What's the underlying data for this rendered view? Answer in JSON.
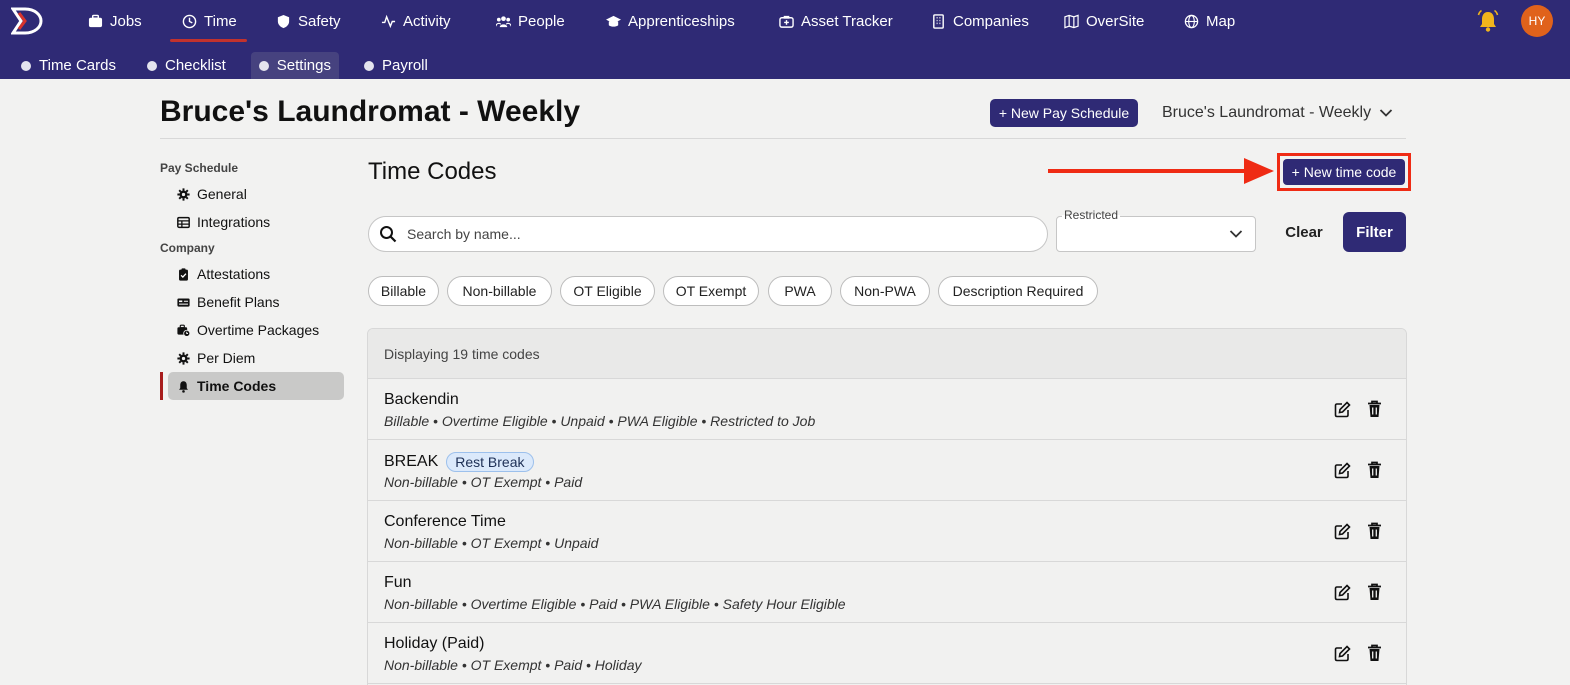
{
  "colors": {
    "nav_bg": "#2f2a75",
    "accent_red": "#c2322d",
    "highlight_box": "#ef2b14",
    "primary_button": "#2f2a75"
  },
  "top_nav": {
    "items": [
      {
        "label": "Jobs",
        "icon": "briefcase-icon"
      },
      {
        "label": "Time",
        "icon": "clock-icon",
        "active": true
      },
      {
        "label": "Safety",
        "icon": "shield-icon"
      },
      {
        "label": "Activity",
        "icon": "activity-icon"
      },
      {
        "label": "People",
        "icon": "people-icon"
      },
      {
        "label": "Apprenticeships",
        "icon": "graduation-cap-icon"
      },
      {
        "label": "Asset Tracker",
        "icon": "camera-plus-icon"
      },
      {
        "label": "Companies",
        "icon": "building-icon"
      },
      {
        "label": "OverSite",
        "icon": "map-fold-icon"
      },
      {
        "label": "Map",
        "icon": "globe-icon"
      }
    ],
    "avatar_initials": "HY"
  },
  "sub_nav": {
    "items": [
      {
        "label": "Time Cards"
      },
      {
        "label": "Checklist"
      },
      {
        "label": "Settings",
        "active": true
      },
      {
        "label": "Payroll"
      }
    ]
  },
  "header": {
    "title": "Bruce's Laundromat - Weekly",
    "new_schedule_button": "+ New Pay Schedule",
    "schedule_select_value": "Bruce's Laundromat - Weekly"
  },
  "sidebar": {
    "group_pay_schedule": "Pay Schedule",
    "group_company": "Company",
    "items": [
      {
        "label": "General",
        "icon": "gear-icon"
      },
      {
        "label": "Integrations",
        "icon": "table-icon"
      },
      {
        "label": "Attestations",
        "icon": "clipboard-check-icon"
      },
      {
        "label": "Benefit Plans",
        "icon": "id-card-icon"
      },
      {
        "label": "Overtime Packages",
        "icon": "briefcase-clock-icon"
      },
      {
        "label": "Per Diem",
        "icon": "gear-icon"
      },
      {
        "label": "Time Codes",
        "icon": "bell-icon",
        "active": true
      }
    ]
  },
  "main": {
    "title": "Time Codes",
    "new_time_code_button": "+ New time code",
    "search": {
      "placeholder": "Search by name...",
      "value": ""
    },
    "restricted": {
      "label": "Restricted",
      "value": ""
    },
    "clear_button": "Clear",
    "filter_button": "Filter",
    "chips": [
      "Billable",
      "Non-billable",
      "OT Eligible",
      "OT Exempt",
      "PWA",
      "Non-PWA",
      "Description Required"
    ],
    "table": {
      "header_text": "Displaying 19 time codes",
      "rows": [
        {
          "name": "Backendin",
          "badge": "",
          "description": "Billable • Overtime Eligible • Unpaid • PWA Eligible • Restricted to Job"
        },
        {
          "name": "BREAK",
          "badge": "Rest Break",
          "description": "Non-billable • OT Exempt • Paid"
        },
        {
          "name": "Conference Time",
          "badge": "",
          "description": "Non-billable • OT Exempt • Unpaid"
        },
        {
          "name": "Fun",
          "badge": "",
          "description": "Non-billable • Overtime Eligible • Paid • PWA Eligible • Safety Hour Eligible"
        },
        {
          "name": "Holiday (Paid)",
          "badge": "",
          "description": "Non-billable • OT Exempt • Paid • Holiday"
        }
      ]
    }
  }
}
